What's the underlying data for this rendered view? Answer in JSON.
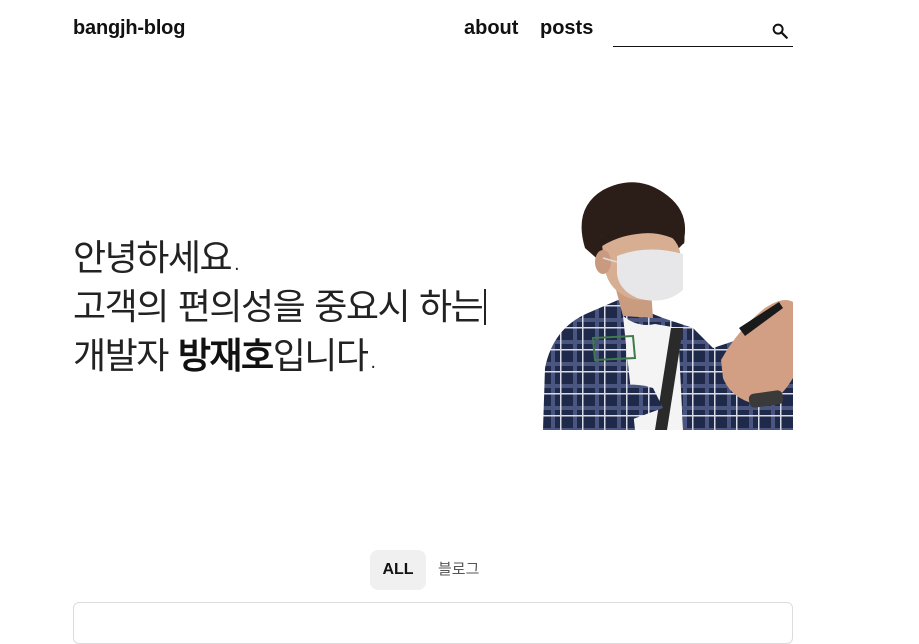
{
  "header": {
    "brand": "bangjh-blog",
    "nav": [
      {
        "label": "about"
      },
      {
        "label": "posts"
      }
    ],
    "search": {
      "value": "",
      "placeholder": "",
      "icon": "search-icon"
    }
  },
  "hero": {
    "line1": "안녕하세요.",
    "line2": "고객의 편의성을 중요시 하는",
    "line3_prefix": "개발자 ",
    "line3_name": "방재호",
    "line3_suffix": "입니다.",
    "portrait": "portrait-illustration"
  },
  "categories": {
    "items": [
      {
        "label": "ALL",
        "active": true
      },
      {
        "label": "블로그",
        "active": false
      }
    ]
  },
  "colors": {
    "text": "#111111",
    "chip_bg": "#f0f0f0",
    "card_border": "#dcdcdc",
    "shirt_plaid": "#1f2a4a"
  }
}
